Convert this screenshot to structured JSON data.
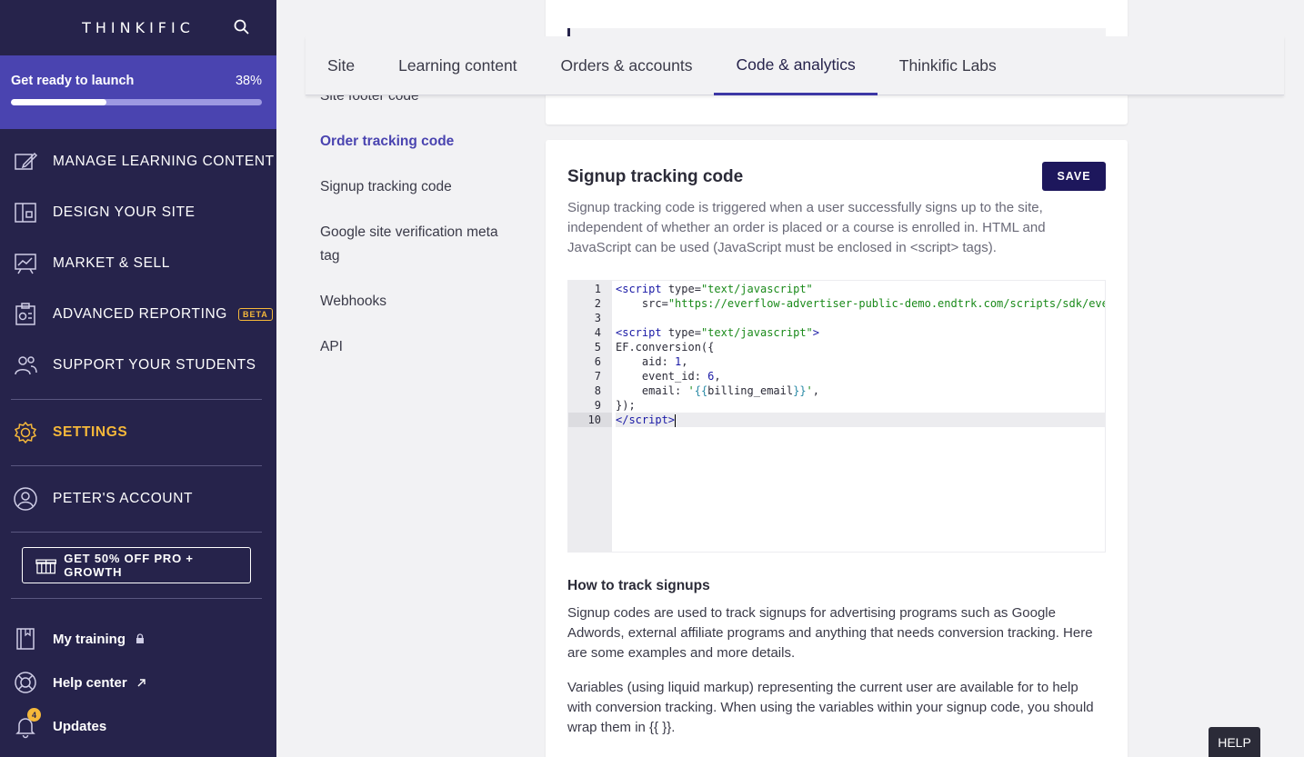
{
  "sidebar": {
    "logo": "THINKIFIC",
    "launch": {
      "label": "Get ready to launch",
      "percent_text": "38%",
      "progress": 0.38
    },
    "nav": [
      {
        "label": "MANAGE LEARNING CONTENT",
        "icon": "pencil-square-icon"
      },
      {
        "label": "DESIGN YOUR SITE",
        "icon": "layout-icon"
      },
      {
        "label": "MARKET & SELL",
        "icon": "chart-board-icon"
      },
      {
        "label": "ADVANCED REPORTING",
        "icon": "report-icon",
        "badge": "BETA"
      },
      {
        "label": "SUPPORT YOUR STUDENTS",
        "icon": "people-icon"
      }
    ],
    "settings": "SETTINGS",
    "account": "PETER'S ACCOUNT",
    "promo": "GET 50% OFF PRO + GROWTH",
    "bottom": [
      {
        "label": "My training",
        "icon": "book-icon"
      },
      {
        "label": "Help center",
        "icon": "lifebuoy-icon"
      },
      {
        "label": "Updates",
        "icon": "bell-icon",
        "count": "4"
      }
    ]
  },
  "tabs": [
    "Site",
    "Learning content",
    "Orders & accounts",
    "Code & analytics",
    "Thinkific Labs"
  ],
  "active_tab": "Code & analytics",
  "subnav": {
    "site_footer": "Site footer code",
    "order_tracking": "Order tracking code",
    "signup_tracking": "Signup tracking code",
    "google_verification": "Google site verification meta tag",
    "webhooks": "Webhooks",
    "api": "API"
  },
  "card": {
    "title": "Signup tracking code",
    "save_label": "SAVE",
    "description": "Signup tracking code is triggered when a user successfully signs up to the site, independent of whether an order is placed or a course is enrolled in. HTML and JavaScript can be used (JavaScript must be enclosed in <script> tags).",
    "line_numbers": [
      "1",
      "2",
      "3",
      "4",
      "5",
      "6",
      "7",
      "8",
      "9",
      "10"
    ],
    "how_title": "How to track signups",
    "how_p1": "Signup codes are used to track signups for advertising programs such as Google Adwords, external affiliate programs and anything that needs conversion tracking. Here are some examples and more details.",
    "how_p2": "Variables (using liquid markup) representing the current user are available for to help with conversion tracking. When using the variables within your signup code, you should wrap them in {{ }}."
  },
  "help": "HELP"
}
